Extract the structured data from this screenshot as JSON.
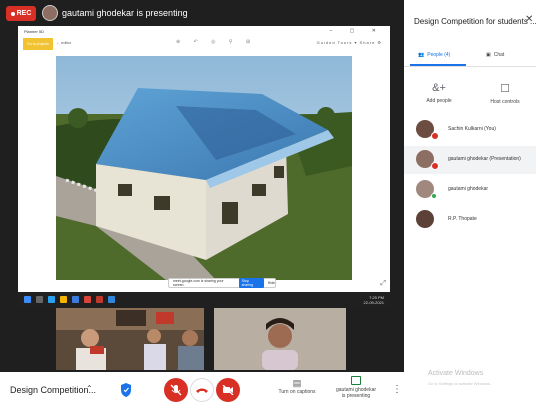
{
  "top_bar": {
    "rec_label": "REC",
    "presenter_text": "gautami ghodekar is presenting"
  },
  "shared_screen": {
    "window_title": "Planner 5D",
    "window_controls": "–  ▢  ✕",
    "left_chip_label": "Go to projects",
    "left_tool_label": "← editor",
    "right_tools_label": "Guided Tours ▾   Share   ⚙",
    "share_bar": {
      "message": "meet.google.com is sharing your screen.",
      "stop_label": "Stop sharing",
      "hide_label": "Hide"
    },
    "taskbar_time": "7:25 PM",
    "taskbar_date": "22-09-2021"
  },
  "bottom_bar": {
    "meeting_name": "Design Competition...",
    "captions_label": "Turn on captions",
    "present_label_line1": "gautami ghodekar",
    "present_label_line2": "is presenting"
  },
  "panel": {
    "title": "Design Competition for students ...",
    "tabs": [
      {
        "label": "People (4)"
      },
      {
        "label": "Chat"
      }
    ],
    "actions": {
      "add_label": "Add people",
      "call_label": "Host controls"
    },
    "participants": [
      {
        "name": "Sachin Kulkarni (You)",
        "muted": true,
        "highlighted": false
      },
      {
        "name": "gautami ghodekar (Presentation)",
        "muted": true,
        "highlighted": true
      },
      {
        "name": "gautami ghodekar",
        "muted": false,
        "highlighted": false
      },
      {
        "name": "R.P. Thopate",
        "muted": false,
        "highlighted": false
      }
    ],
    "watermark_title": "Activate Windows",
    "watermark_sub": "Go to Settings to activate Windows."
  },
  "colors": {
    "accent": "#1a73e8",
    "danger": "#d93025",
    "stage_bg": "#1f1f1f"
  }
}
